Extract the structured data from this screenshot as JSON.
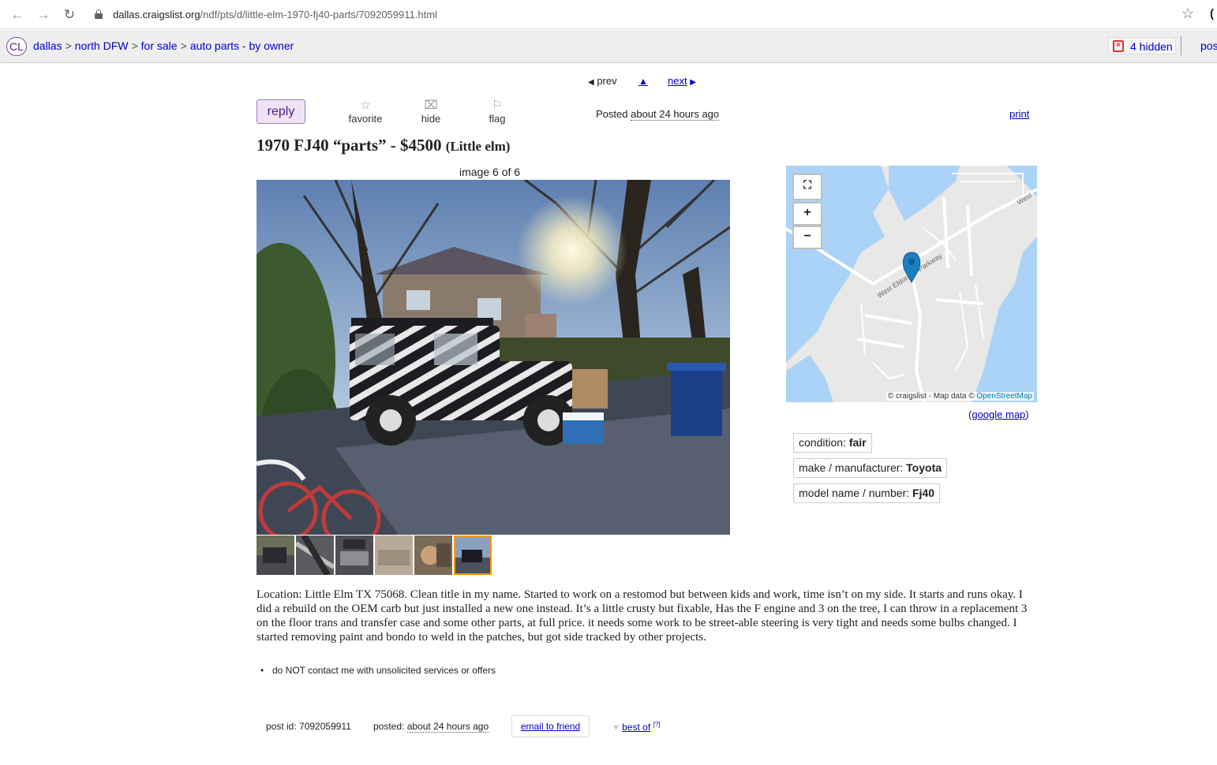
{
  "browser": {
    "url_domain": "dallas.craigslist.org",
    "url_path": "/ndf/pts/d/little-elm-1970-fj40-parts/7092059911.html"
  },
  "header": {
    "logo": "CL",
    "breadcrumbs": [
      "dallas",
      "north DFW",
      "for sale",
      "auto parts - by owner"
    ],
    "hidden_label": "4 hidden",
    "post_label": "pos"
  },
  "nav": {
    "prev": "prev",
    "up": "▲",
    "next": "next"
  },
  "actions": {
    "reply": "reply",
    "favorite": "favorite",
    "hide": "hide",
    "flag": "flag",
    "posted_label": "Posted",
    "posted_time": "about 24 hours ago",
    "print": "print"
  },
  "posting": {
    "title": "1970 FJ40 “parts”",
    "price": "$4500",
    "location": "(Little elm)",
    "image_counter": "image 6 of 6",
    "body": "Location: Little Elm TX 75068. Clean title in my name. Started to work on a restomod but between kids and work, time isn’t on my side. It starts and runs okay. I did a rebuild on the OEM carb but just installed a new one instead. It’s a little crusty but fixable, Has the F engine and 3 on the tree, I can throw in a replacement 3 on the floor trans and transfer case and some other parts, at full price. it needs some work to be street-able steering is very tight and needs some bulbs changed. I started removing paint and bondo to weld in the patches, but got side tracked by other projects.",
    "notice": "do NOT contact me with unsolicited services or offers"
  },
  "map": {
    "road_label": "West Eldorado Parkway",
    "road_label_short": "West",
    "attribution_prefix": "© craigslist - Map data ©",
    "attribution_osm": "OpenStreetMap",
    "google_map": "google map"
  },
  "attributes": [
    {
      "label": "condition:",
      "value": "fair"
    },
    {
      "label": "make / manufacturer:",
      "value": "Toyota"
    },
    {
      "label": "model name / number:",
      "value": "Fj40"
    }
  ],
  "footer": {
    "post_id": "post id: 7092059911",
    "posted_label": "posted:",
    "posted_time": "about 24 hours ago",
    "email": "email to friend",
    "best_of": "best of",
    "best_of_sup": "[?]"
  },
  "colors": {
    "link": "#0000cc",
    "reply_bg": "#eee3f5",
    "water": "#abd3f7",
    "pin": "#1a7fc1",
    "thumb_active": "#ff9900"
  }
}
